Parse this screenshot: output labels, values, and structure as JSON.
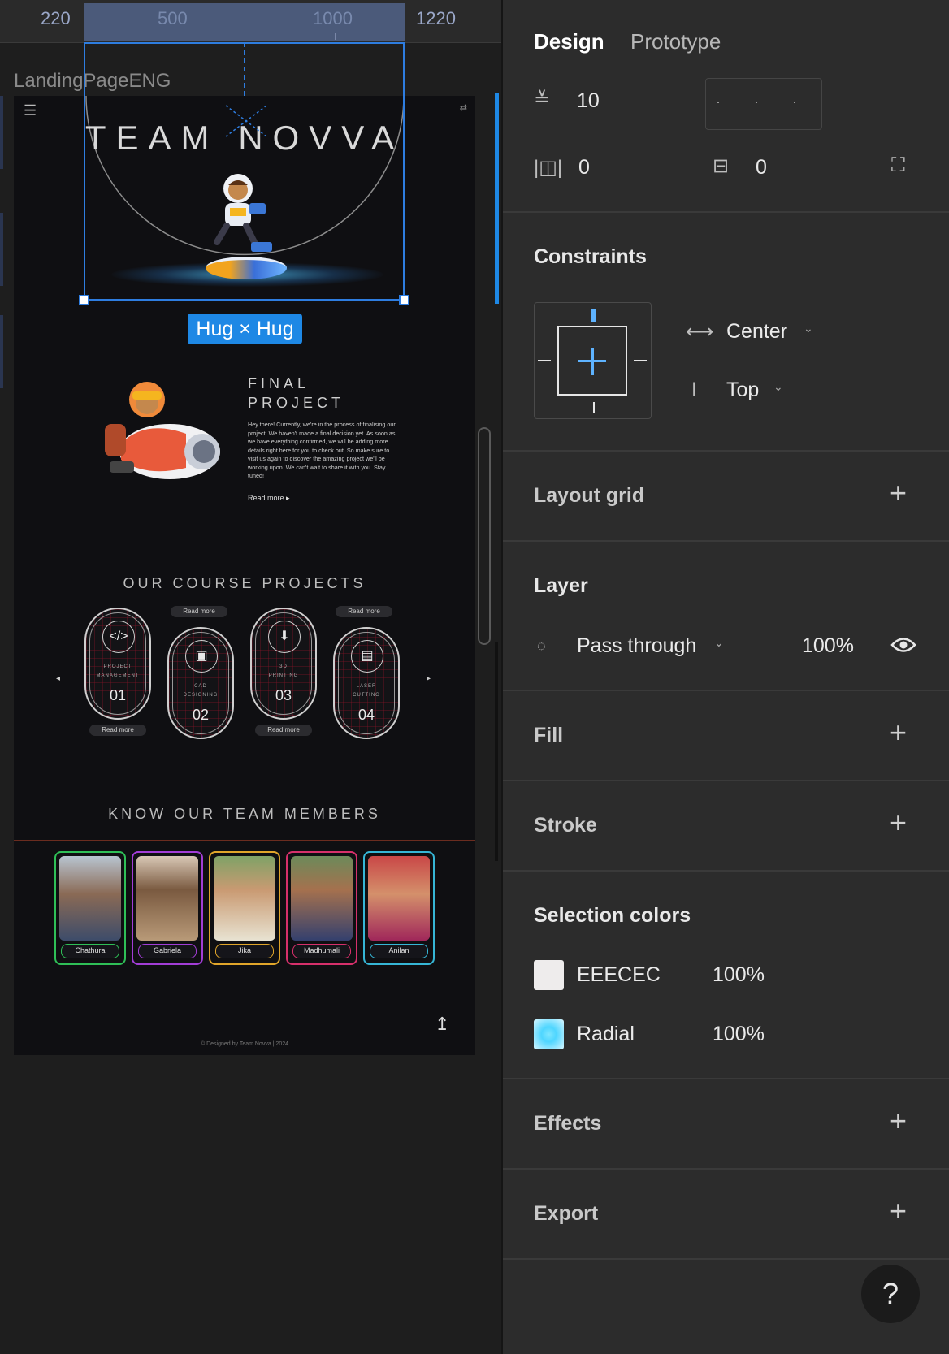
{
  "canvas": {
    "ruler": {
      "marks": [
        "220",
        "500",
        "1000",
        "1220"
      ]
    },
    "frame_label": "LandingPageENG",
    "selection_badge": "Hug × Hug",
    "site": {
      "menu_icon": "menu-icon",
      "lang_icon": "translate-icon",
      "hero_title": "TEAM NOVVA",
      "final_project": {
        "title_line1": "FINAL",
        "title_line2": "PROJECT",
        "body": "Hey there! Currently, we're in the process of finalising our project. We haven't made a final decision yet. As soon as we have everything confirmed, we will be adding more details right here for you to check out. So make sure to visit us again to discover the amazing project we'll be working upon. We can't wait to share it with you. Stay tuned!",
        "read_more": "Read more ▸"
      },
      "courses": {
        "title": "OUR COURSE PROJECTS",
        "prev": "◂",
        "next": "▸",
        "items": [
          {
            "icon": "</>",
            "label_line1": "PROJECT",
            "label_line2": "MANAGEMENT",
            "number": "01",
            "read_more": "Read more"
          },
          {
            "icon": "▣",
            "label_line1": "CAD",
            "label_line2": "DESIGNING",
            "number": "02",
            "read_more": "Read more"
          },
          {
            "icon": "⬇",
            "label_line1": "3D",
            "label_line2": "PRINTING",
            "number": "03",
            "read_more": "Read more"
          },
          {
            "icon": "▤",
            "label_line1": "LASER",
            "label_line2": "CUTTING",
            "number": "04",
            "read_more": "Read more"
          }
        ]
      },
      "team": {
        "title": "KNOW OUR TEAM MEMBERS",
        "members": [
          {
            "name": "Chathura",
            "color": "#2fbf57"
          },
          {
            "name": "Gabriela",
            "color": "#a23dd6"
          },
          {
            "name": "Jika",
            "color": "#e0a52a"
          },
          {
            "name": "Madhumali",
            "color": "#d6306b"
          },
          {
            "name": "Anilan",
            "color": "#36b6d6"
          }
        ]
      },
      "up_icon": "↥",
      "footer": "© Designed by Team Novva | 2024"
    }
  },
  "panel": {
    "tabs": {
      "design": "Design",
      "prototype": "Prototype"
    },
    "auto_layout": {
      "spacing_icon": "≚",
      "spacing": "10",
      "dots": "· · ·",
      "padding_h_icon": "|◫|",
      "padding_h": "0",
      "padding_v_icon": "⊟",
      "padding_v": "0",
      "resize_icon": "⛶"
    },
    "constraints": {
      "title": "Constraints",
      "horizontal_icon": "⟷",
      "horizontal": "Center",
      "vertical_icon": "I",
      "vertical": "Top",
      "chevron": "⌄"
    },
    "layout_grid": {
      "title": "Layout grid",
      "add": "+"
    },
    "layer": {
      "title": "Layer",
      "blend_icon": "💧",
      "blend": "Pass through",
      "chevron": "⌄",
      "opacity": "100%",
      "visibility_icon": "👁"
    },
    "fill": {
      "title": "Fill",
      "add": "+"
    },
    "stroke": {
      "title": "Stroke",
      "add": "+"
    },
    "selection_colors": {
      "title": "Selection colors",
      "items": [
        {
          "name": "EEECEC",
          "opacity": "100%",
          "color": "#EEECEC"
        },
        {
          "name": "Radial",
          "opacity": "100%",
          "color": "#4fd6ff"
        }
      ]
    },
    "effects": {
      "title": "Effects",
      "add": "+"
    },
    "export": {
      "title": "Export",
      "add": "+"
    },
    "help": "?"
  }
}
